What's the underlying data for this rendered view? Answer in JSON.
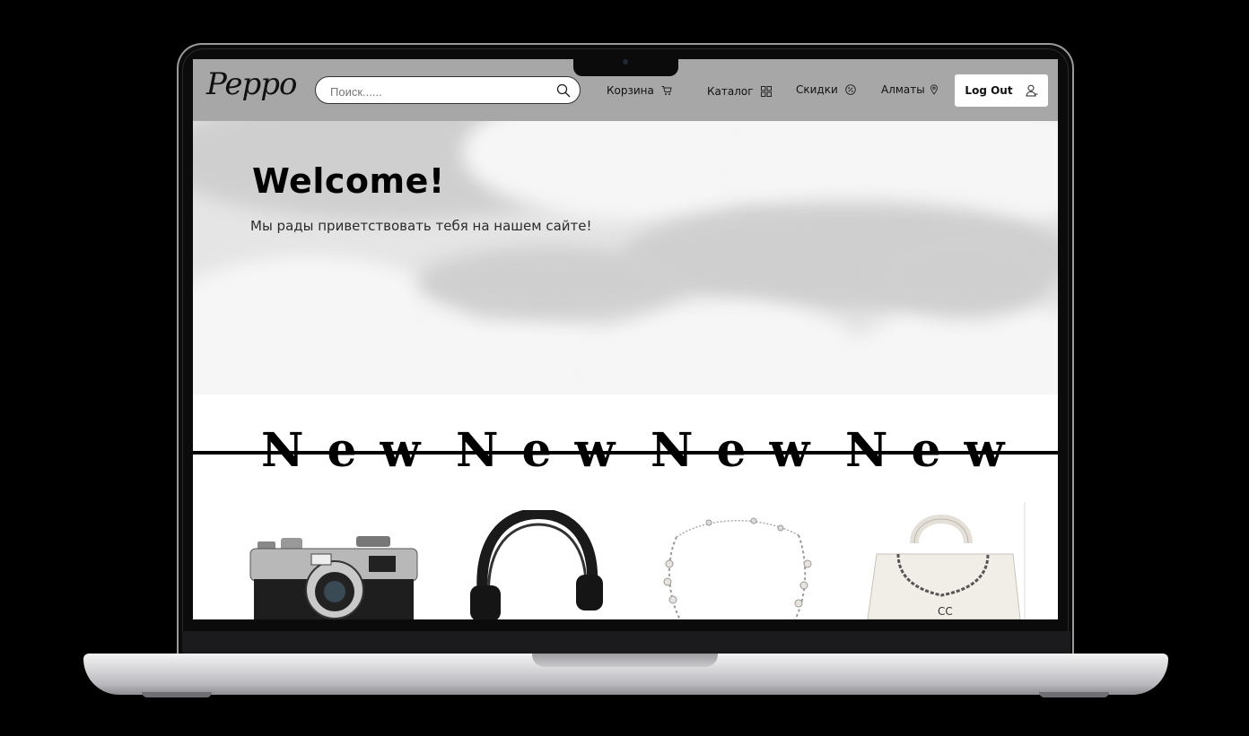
{
  "header": {
    "logo": "Peppo",
    "search_placeholder": "Поиск......",
    "nav": {
      "cart": "Корзина",
      "catalog": "Каталог",
      "sale": "Скидки",
      "city": "Алматы"
    },
    "logout": "Log Out"
  },
  "hero": {
    "title": "Welcome!",
    "subtitle": "Мы рады приветствовать тебя на нашем сайте!"
  },
  "new_banner": [
    "New",
    "New",
    "New",
    "New"
  ],
  "products": [
    {
      "icon": "camera-icon"
    },
    {
      "icon": "headphones-icon"
    },
    {
      "icon": "necklace-icon"
    },
    {
      "icon": "handbag-icon"
    }
  ],
  "colors": {
    "header_bg": "#a7a7a7",
    "text": "#111111"
  }
}
